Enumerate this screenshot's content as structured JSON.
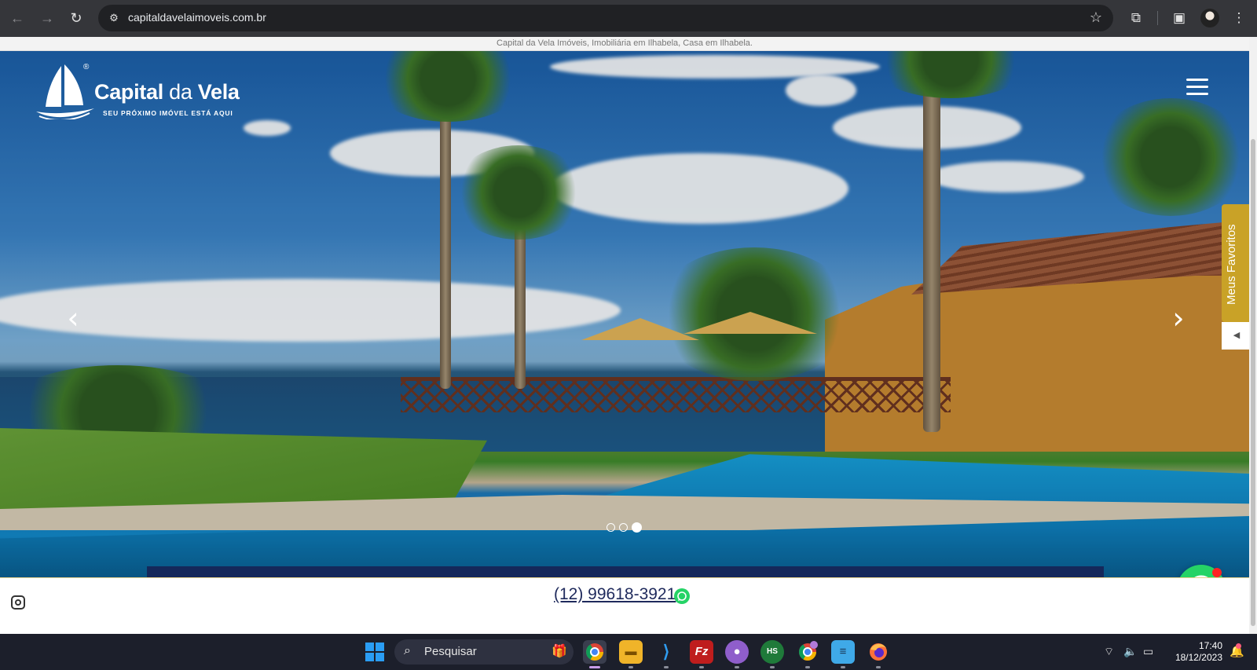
{
  "browser": {
    "url": "capitaldavelaimoveis.com.br",
    "icons": [
      "back-icon",
      "forward-icon",
      "reload-icon",
      "site-info-icon",
      "bookmark-star-icon",
      "extensions-icon",
      "side-panel-icon",
      "profile-avatar",
      "menu-kebab-icon"
    ]
  },
  "site": {
    "top_text": "Capital da Vela Imóveis, Imobiliária em Ilhabela, Casa em Ilhabela.",
    "logo": {
      "brand_bold": "Capital",
      "brand_light": " da ",
      "brand_bold2": "Vela",
      "registered": "®",
      "tagline": "SEU PRÓXIMO IMÓVEL ESTÁ AQUI"
    },
    "carousel": {
      "prev": "‹",
      "next": "›",
      "slides": 3,
      "active_slide": 3
    },
    "favorites": {
      "label": "Meus Favoritos",
      "toggle": "◀"
    },
    "footer": {
      "phone": "(12) 99618-3921"
    },
    "colors": {
      "brand_navy": "#15285a",
      "gold": "#c9a227",
      "whatsapp": "#25d366"
    }
  },
  "taskbar": {
    "search_label": "Pesquisar",
    "apps": [
      "chrome",
      "file-explorer",
      "vscode",
      "filezilla",
      "github-desktop",
      "hs-app",
      "chrome-profile",
      "notepad",
      "firefox"
    ],
    "clock_time": "17:40",
    "clock_date": "18/12/2023"
  }
}
